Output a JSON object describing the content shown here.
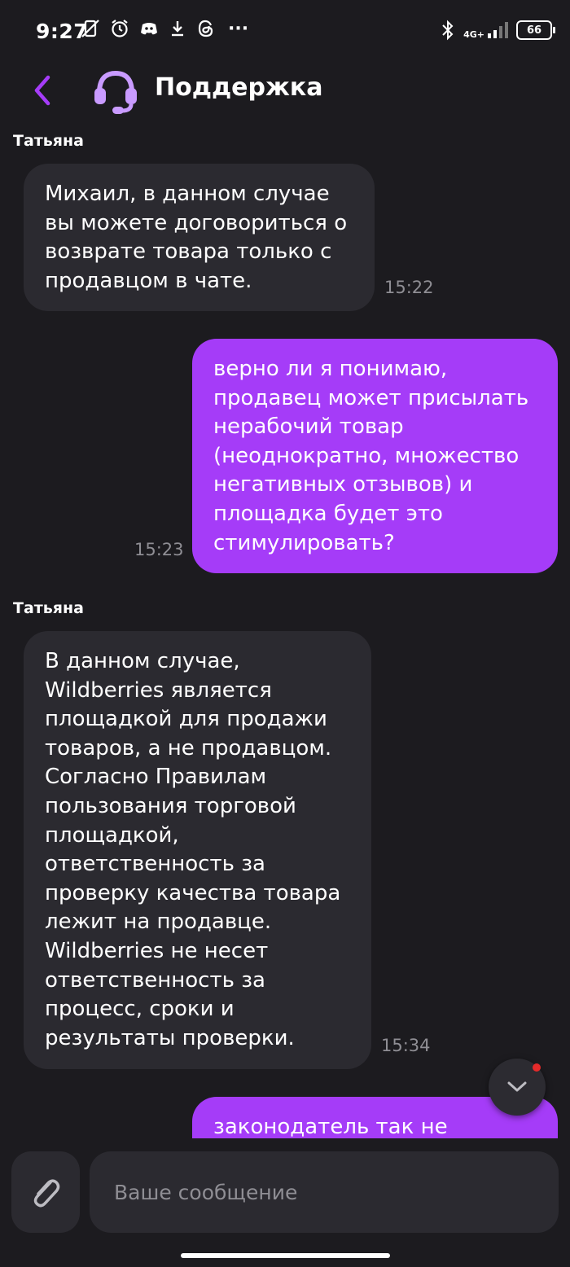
{
  "status_bar": {
    "time": "9:27",
    "network": "4G+",
    "battery": "66",
    "more": "···"
  },
  "header": {
    "title": "Поддержка",
    "accent_color": "#a53cf8"
  },
  "messages": [
    {
      "direction": "incoming",
      "sender": "Татьяна",
      "text": "Михаил, в данном случае\nвы можете договориться о\nвозврате товара только с\nпродавцом в чате.",
      "time": "15:22"
    },
    {
      "direction": "outgoing",
      "text": "верно ли я понимаю,\nпродавец может присылать\nнерабочий товар\n(неоднократно, множество\nнегативных отзывов) и\nплощадка будет это\nстимулировать?",
      "time": "15:23"
    },
    {
      "direction": "incoming",
      "sender": "Татьяна",
      "text": "В данном случае,\nWildberries является\nплощадкой для продажи\nтоваров, а не продавцом.\nСогласно Правилам\nпользования торговой\nплощадкой,\nответственность за\nпроверку качества товара\nлежит на продавце.\nWildberries не несет\nответственность за\nпроцесс, сроки и\nрезультаты проверки.",
      "time": "15:34"
    },
    {
      "direction": "outgoing",
      "text": "законодатель так не"
    }
  ],
  "composer": {
    "placeholder": "Ваше сообщение"
  }
}
